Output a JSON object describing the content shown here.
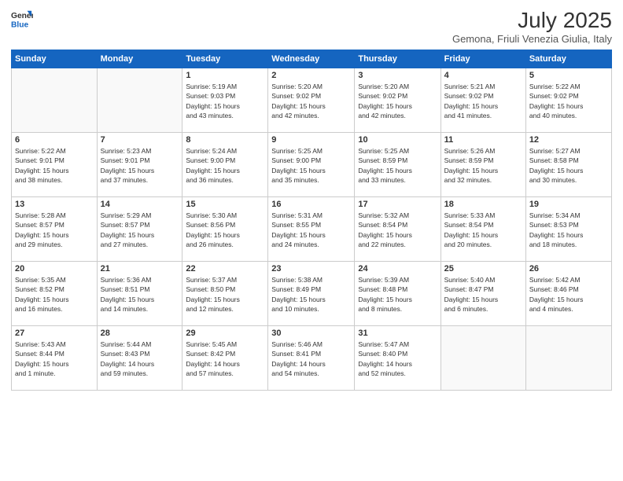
{
  "header": {
    "logo_line1": "General",
    "logo_line2": "Blue",
    "month_title": "July 2025",
    "subtitle": "Gemona, Friuli Venezia Giulia, Italy"
  },
  "days_of_week": [
    "Sunday",
    "Monday",
    "Tuesday",
    "Wednesday",
    "Thursday",
    "Friday",
    "Saturday"
  ],
  "weeks": [
    [
      {
        "day": "",
        "info": ""
      },
      {
        "day": "",
        "info": ""
      },
      {
        "day": "1",
        "info": "Sunrise: 5:19 AM\nSunset: 9:03 PM\nDaylight: 15 hours\nand 43 minutes."
      },
      {
        "day": "2",
        "info": "Sunrise: 5:20 AM\nSunset: 9:02 PM\nDaylight: 15 hours\nand 42 minutes."
      },
      {
        "day": "3",
        "info": "Sunrise: 5:20 AM\nSunset: 9:02 PM\nDaylight: 15 hours\nand 42 minutes."
      },
      {
        "day": "4",
        "info": "Sunrise: 5:21 AM\nSunset: 9:02 PM\nDaylight: 15 hours\nand 41 minutes."
      },
      {
        "day": "5",
        "info": "Sunrise: 5:22 AM\nSunset: 9:02 PM\nDaylight: 15 hours\nand 40 minutes."
      }
    ],
    [
      {
        "day": "6",
        "info": "Sunrise: 5:22 AM\nSunset: 9:01 PM\nDaylight: 15 hours\nand 38 minutes."
      },
      {
        "day": "7",
        "info": "Sunrise: 5:23 AM\nSunset: 9:01 PM\nDaylight: 15 hours\nand 37 minutes."
      },
      {
        "day": "8",
        "info": "Sunrise: 5:24 AM\nSunset: 9:00 PM\nDaylight: 15 hours\nand 36 minutes."
      },
      {
        "day": "9",
        "info": "Sunrise: 5:25 AM\nSunset: 9:00 PM\nDaylight: 15 hours\nand 35 minutes."
      },
      {
        "day": "10",
        "info": "Sunrise: 5:25 AM\nSunset: 8:59 PM\nDaylight: 15 hours\nand 33 minutes."
      },
      {
        "day": "11",
        "info": "Sunrise: 5:26 AM\nSunset: 8:59 PM\nDaylight: 15 hours\nand 32 minutes."
      },
      {
        "day": "12",
        "info": "Sunrise: 5:27 AM\nSunset: 8:58 PM\nDaylight: 15 hours\nand 30 minutes."
      }
    ],
    [
      {
        "day": "13",
        "info": "Sunrise: 5:28 AM\nSunset: 8:57 PM\nDaylight: 15 hours\nand 29 minutes."
      },
      {
        "day": "14",
        "info": "Sunrise: 5:29 AM\nSunset: 8:57 PM\nDaylight: 15 hours\nand 27 minutes."
      },
      {
        "day": "15",
        "info": "Sunrise: 5:30 AM\nSunset: 8:56 PM\nDaylight: 15 hours\nand 26 minutes."
      },
      {
        "day": "16",
        "info": "Sunrise: 5:31 AM\nSunset: 8:55 PM\nDaylight: 15 hours\nand 24 minutes."
      },
      {
        "day": "17",
        "info": "Sunrise: 5:32 AM\nSunset: 8:54 PM\nDaylight: 15 hours\nand 22 minutes."
      },
      {
        "day": "18",
        "info": "Sunrise: 5:33 AM\nSunset: 8:54 PM\nDaylight: 15 hours\nand 20 minutes."
      },
      {
        "day": "19",
        "info": "Sunrise: 5:34 AM\nSunset: 8:53 PM\nDaylight: 15 hours\nand 18 minutes."
      }
    ],
    [
      {
        "day": "20",
        "info": "Sunrise: 5:35 AM\nSunset: 8:52 PM\nDaylight: 15 hours\nand 16 minutes."
      },
      {
        "day": "21",
        "info": "Sunrise: 5:36 AM\nSunset: 8:51 PM\nDaylight: 15 hours\nand 14 minutes."
      },
      {
        "day": "22",
        "info": "Sunrise: 5:37 AM\nSunset: 8:50 PM\nDaylight: 15 hours\nand 12 minutes."
      },
      {
        "day": "23",
        "info": "Sunrise: 5:38 AM\nSunset: 8:49 PM\nDaylight: 15 hours\nand 10 minutes."
      },
      {
        "day": "24",
        "info": "Sunrise: 5:39 AM\nSunset: 8:48 PM\nDaylight: 15 hours\nand 8 minutes."
      },
      {
        "day": "25",
        "info": "Sunrise: 5:40 AM\nSunset: 8:47 PM\nDaylight: 15 hours\nand 6 minutes."
      },
      {
        "day": "26",
        "info": "Sunrise: 5:42 AM\nSunset: 8:46 PM\nDaylight: 15 hours\nand 4 minutes."
      }
    ],
    [
      {
        "day": "27",
        "info": "Sunrise: 5:43 AM\nSunset: 8:44 PM\nDaylight: 15 hours\nand 1 minute."
      },
      {
        "day": "28",
        "info": "Sunrise: 5:44 AM\nSunset: 8:43 PM\nDaylight: 14 hours\nand 59 minutes."
      },
      {
        "day": "29",
        "info": "Sunrise: 5:45 AM\nSunset: 8:42 PM\nDaylight: 14 hours\nand 57 minutes."
      },
      {
        "day": "30",
        "info": "Sunrise: 5:46 AM\nSunset: 8:41 PM\nDaylight: 14 hours\nand 54 minutes."
      },
      {
        "day": "31",
        "info": "Sunrise: 5:47 AM\nSunset: 8:40 PM\nDaylight: 14 hours\nand 52 minutes."
      },
      {
        "day": "",
        "info": ""
      },
      {
        "day": "",
        "info": ""
      }
    ]
  ]
}
